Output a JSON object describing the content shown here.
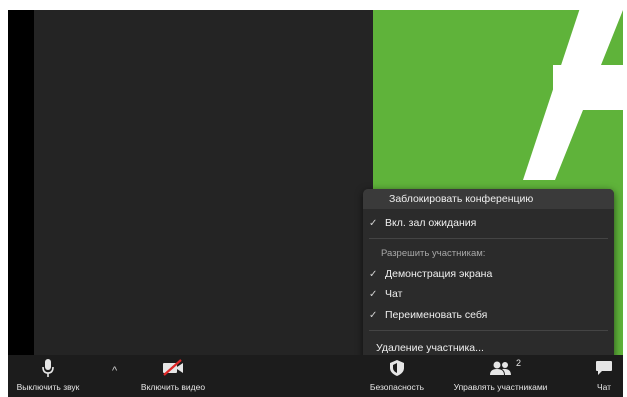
{
  "security_menu": {
    "lock_meeting": "Заблокировать конференцию",
    "waiting_room": "Вкл. зал ожидания",
    "allow_heading": "Разрешить участникам:",
    "share_screen": "Демонстрация экрана",
    "chat": "Чат",
    "rename_self": "Переименовать себя",
    "remove_participant": "Удаление участника...",
    "check_mark": "✓"
  },
  "toolbar": {
    "mute_label": "Выключить звук",
    "video_label": "Включить видео",
    "security_label": "Безопасность",
    "participants_label": "Управлять участниками",
    "participants_count": "2",
    "chat_label": "Чат",
    "caret": "^"
  },
  "colors": {
    "share_green": "#5fb33a",
    "video_off_red": "#e02828"
  }
}
